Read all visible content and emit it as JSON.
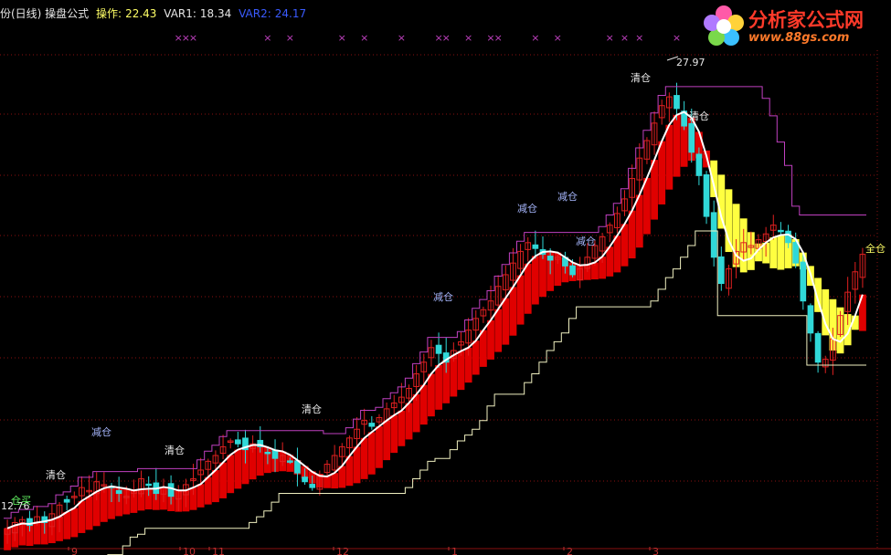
{
  "header": {
    "title": "份(日线) 操盘公式",
    "op_label": "操作:",
    "op_value": "22.43",
    "var1_label": "VAR1:",
    "var1_value": "18.34",
    "var2_label": "VAR2:",
    "var2_value": "24.17"
  },
  "logo": {
    "brand_text": "分析家公式网",
    "url_text": "www.88gs.com"
  },
  "colors": {
    "background": "#000000",
    "grid": "#8a1010",
    "candle_up": "#e02020",
    "candle_down": "#30d8d8",
    "band": "#e00000",
    "band_yellow": "#ffff40",
    "ma_line": "#ffffff",
    "stop_line": "#f0f0c0",
    "top_line": "#c040c0",
    "marker": "#c040c0"
  },
  "chart_data": {
    "type": "candlestick",
    "ylim": [
      12.5,
      29.5
    ],
    "x_count": 116,
    "price_high_label": "27.97",
    "price_low_label": "12.76",
    "closes": [
      13.1,
      13.3,
      13.4,
      13.2,
      13.5,
      13.3,
      13.6,
      13.9,
      14.0,
      14.2,
      14.5,
      14.4,
      14.7,
      14.6,
      14.5,
      14.3,
      14.2,
      14.4,
      14.8,
      14.6,
      14.3,
      14.5,
      14.2,
      14.4,
      14.6,
      14.8,
      15.1,
      15.4,
      15.6,
      15.9,
      16.1,
      16.0,
      15.8,
      16.0,
      15.9,
      15.7,
      15.5,
      15.6,
      15.4,
      15.0,
      14.7,
      14.5,
      14.9,
      15.3,
      15.6,
      15.9,
      16.2,
      16.5,
      16.8,
      16.6,
      16.9,
      17.2,
      17.4,
      17.6,
      17.9,
      18.4,
      18.8,
      19.3,
      19.1,
      18.8,
      19.2,
      19.5,
      19.9,
      20.3,
      20.6,
      20.9,
      21.4,
      21.8,
      22.2,
      22.6,
      22.9,
      22.7,
      22.5,
      22.3,
      22.4,
      22.1,
      21.8,
      22.0,
      22.4,
      22.8,
      23.1,
      23.5,
      23.9,
      24.4,
      25.1,
      25.8,
      26.4,
      27.0,
      27.6,
      27.9,
      27.5,
      26.9,
      26.0,
      25.2,
      23.8,
      22.4,
      21.5,
      22.0,
      22.6,
      22.9,
      22.8,
      23.0,
      23.2,
      23.5,
      23.3,
      22.9,
      22.2,
      20.9,
      19.8,
      18.8,
      18.9,
      19.6,
      20.4,
      21.2,
      21.9,
      22.5
    ]
  },
  "labels": [
    {
      "text": "减仓",
      "kind": "reduce"
    },
    {
      "text": "清仓",
      "kind": "clear"
    },
    {
      "text": "清仓",
      "kind": "clear"
    },
    {
      "text": "清仓",
      "kind": "clear"
    },
    {
      "text": "减仓",
      "kind": "reduce"
    },
    {
      "text": "减仓",
      "kind": "reduce"
    },
    {
      "text": "减仓",
      "kind": "reduce"
    },
    {
      "text": "清仓",
      "kind": "clear"
    },
    {
      "text": "减仓",
      "kind": "reduce"
    },
    {
      "text": "清仓",
      "kind": "clear"
    },
    {
      "text": "全仓",
      "kind": "full"
    },
    {
      "text": "仓买",
      "kind": "buy"
    }
  ],
  "x_axis_ticks": [
    "9",
    "10",
    "11",
    "12",
    "1",
    "2",
    "3"
  ]
}
